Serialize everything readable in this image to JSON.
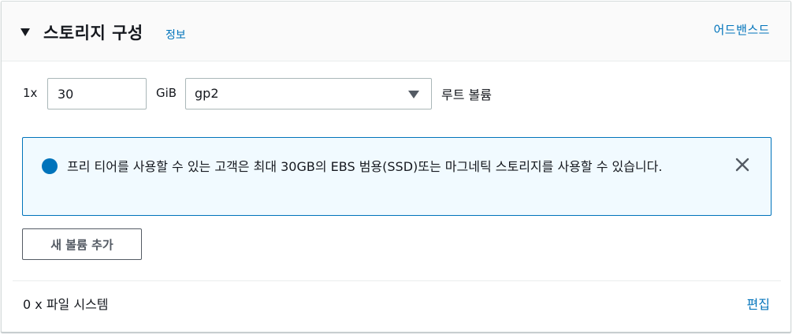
{
  "header": {
    "title": "스토리지 구성",
    "info_link": "정보",
    "advanced_link": "어드밴스드"
  },
  "volume": {
    "count_label": "1x",
    "size_value": "30",
    "unit_label": "GiB",
    "type_selected": "gp2",
    "volume_label": "루트 볼륨"
  },
  "alert": {
    "message": "프리 티어를 사용할 수 있는 고객은 최대 30GB의 EBS 범용(SSD)또는 마그네틱 스토리지를 사용할 수 있습니다."
  },
  "actions": {
    "add_volume_label": "새 볼륨 추가"
  },
  "filesystem": {
    "label": "0 x 파일 시스템",
    "edit_label": "편집"
  },
  "colors": {
    "link": "#0073bb",
    "alert_bg": "#f1faff",
    "alert_border": "#0073bb",
    "text": "#16191f"
  },
  "icons": {
    "expand": "caret-down-icon",
    "info": "info-circle-icon",
    "close": "close-icon",
    "select": "chevron-down-icon"
  }
}
